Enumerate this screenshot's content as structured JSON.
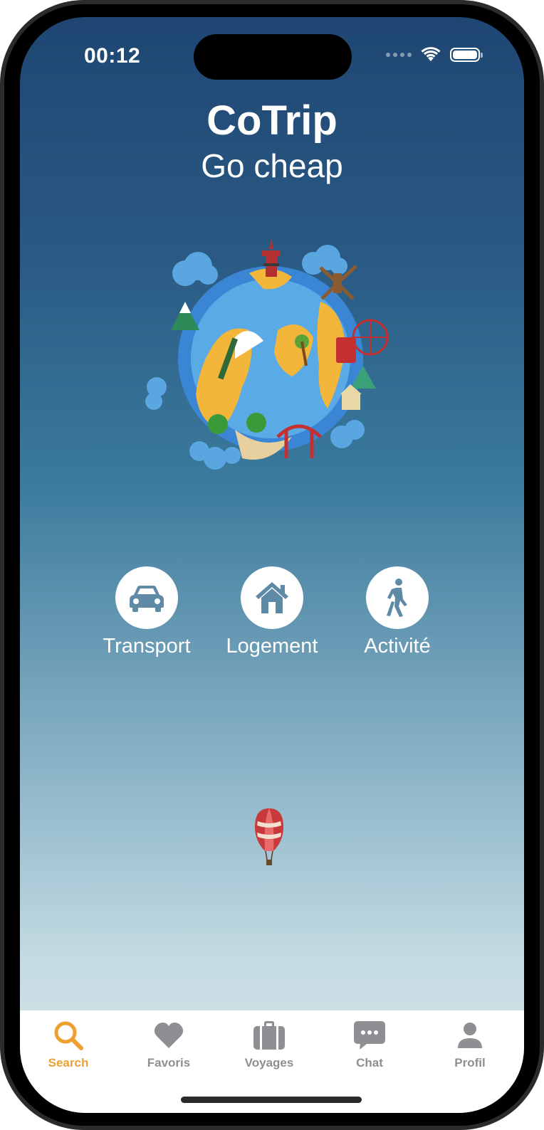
{
  "status_bar": {
    "time": "00:12"
  },
  "header": {
    "title": "CoTrip",
    "subtitle": "Go cheap"
  },
  "categories": [
    {
      "label": "Transport",
      "icon": "car-icon"
    },
    {
      "label": "Logement",
      "icon": "house-icon"
    },
    {
      "label": "Activité",
      "icon": "walking-person-icon"
    }
  ],
  "tabbar": {
    "active_color": "#f0a030",
    "inactive_color": "#8e8e93",
    "items": [
      {
        "label": "Search",
        "icon": "search-icon",
        "active": true
      },
      {
        "label": "Favoris",
        "icon": "heart-icon",
        "active": false
      },
      {
        "label": "Voyages",
        "icon": "suitcase-icon",
        "active": false
      },
      {
        "label": "Chat",
        "icon": "chat-bubble-icon",
        "active": false
      },
      {
        "label": "Profil",
        "icon": "person-icon",
        "active": false
      }
    ]
  },
  "colors": {
    "sky_top": "#1f4672",
    "sky_bottom": "#d9e7ea",
    "icon_tint": "#5e8aa6"
  }
}
